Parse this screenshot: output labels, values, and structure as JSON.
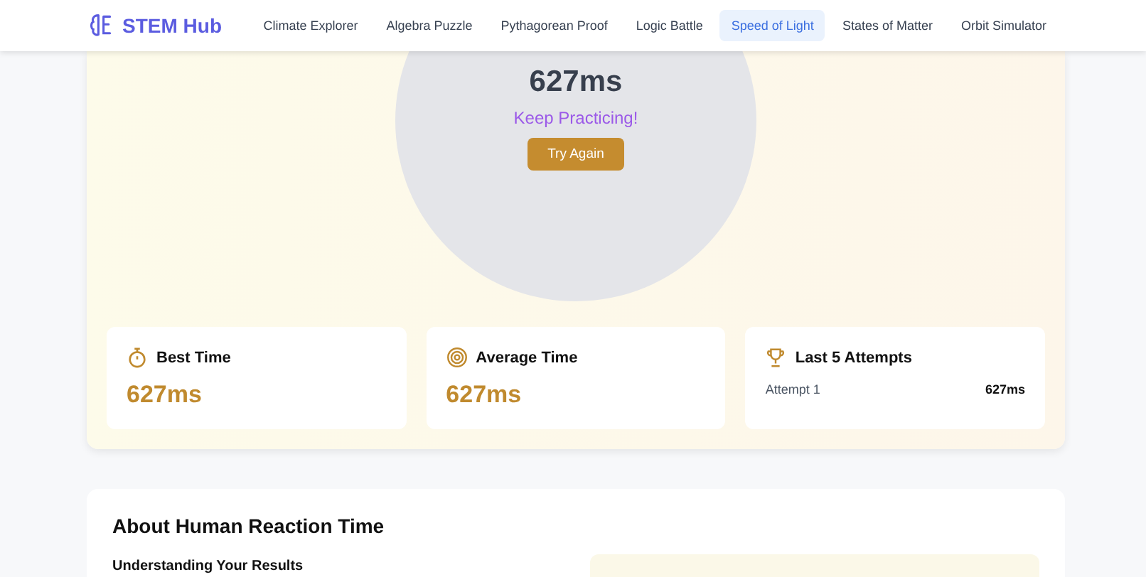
{
  "brand": {
    "name": "STEM Hub"
  },
  "nav": [
    {
      "label": "Climate Explorer",
      "selected": false
    },
    {
      "label": "Algebra Puzzle",
      "selected": false
    },
    {
      "label": "Pythagorean Proof",
      "selected": false
    },
    {
      "label": "Logic Battle",
      "selected": false
    },
    {
      "label": "Speed of Light",
      "selected": true
    },
    {
      "label": "States of Matter",
      "selected": false
    },
    {
      "label": "Orbit Simulator",
      "selected": false
    }
  ],
  "result": {
    "time": "627ms",
    "message": "Keep Practicing!",
    "button": "Try Again"
  },
  "stats": [
    {
      "kind": "stopwatch",
      "title": "Best Time",
      "value": "627ms"
    },
    {
      "kind": "target",
      "title": "Average Time",
      "value": "627ms"
    },
    {
      "kind": "trophy",
      "title": "Last 5 Attempts",
      "attempts": [
        {
          "label": "Attempt 1",
          "value": "627ms"
        }
      ]
    }
  ],
  "about": {
    "title": "About Human Reaction Time",
    "subtitle": "Understanding Your Results"
  }
}
